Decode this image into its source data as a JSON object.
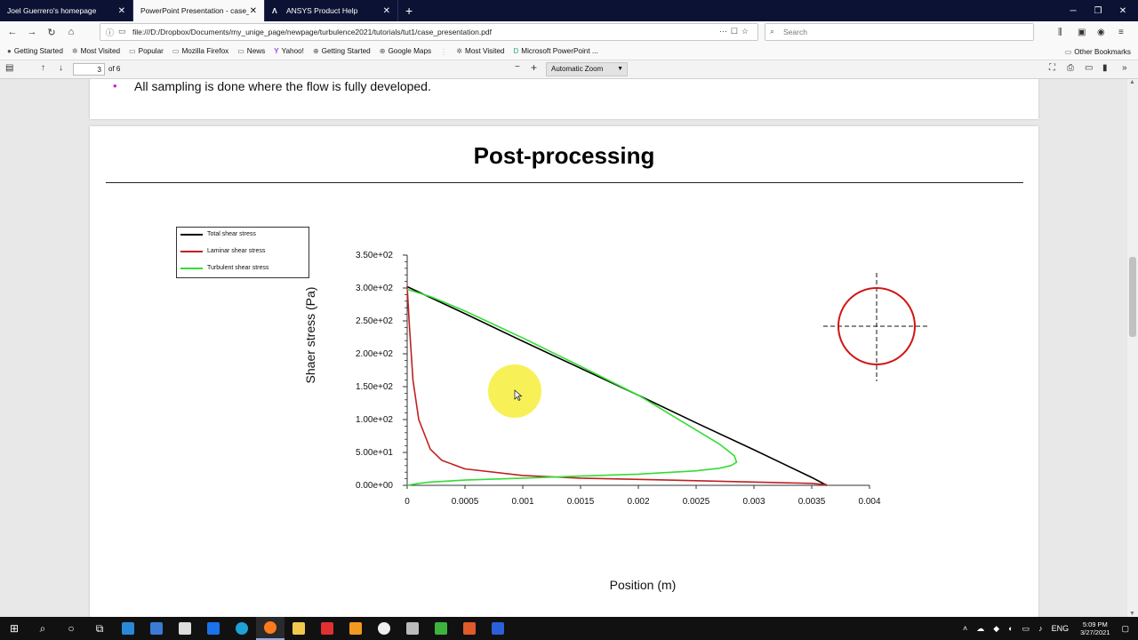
{
  "tabs": [
    {
      "label": "Joel Guerrero's homepage"
    },
    {
      "label": "PowerPoint Presentation - case_pre"
    },
    {
      "label": "ANSYS Product Help"
    }
  ],
  "url": "file:///D:/Dropbox/Documents/my_unige_page/newpage/turbulence2021/tutorials/tut1/case_presentation.pdf",
  "search_placeholder": "Search",
  "bookmarks": [
    "Getting Started",
    "Most Visited",
    "Popular",
    "Mozilla Firefox",
    "News",
    "Yahoo!",
    "Getting Started",
    "Google Maps",
    "Most Visited",
    "Microsoft PowerPoint ..."
  ],
  "other_bookmarks": "Other Bookmarks",
  "pdf": {
    "page": "3",
    "of": "of 6",
    "zoom": "Automatic Zoom"
  },
  "prev_slide": {
    "bullet": "•",
    "text": "All sampling is done where the flow is fully developed."
  },
  "slide": {
    "title": "Post-processing"
  },
  "chart_data": {
    "type": "line",
    "xlabel": "Position (m)",
    "ylabel": "Shaer stress (Pa)",
    "xlim": [
      0,
      0.004
    ],
    "ylim": [
      0,
      350
    ],
    "xticks": [
      "0",
      "0.0005",
      "0.001",
      "0.0015",
      "0.002",
      "0.0025",
      "0.003",
      "0.0035",
      "0.004"
    ],
    "yticks": [
      "0.00e+00",
      "5.00e+01",
      "1.00e+02",
      "1.50e+02",
      "2.00e+02",
      "2.50e+02",
      "3.00e+02",
      "3.50e+02"
    ],
    "legend_position": "top-left",
    "series": [
      {
        "name": "Total shear stress",
        "color": "#000000",
        "x": [
          0,
          0.0005,
          0.001,
          0.0015,
          0.002,
          0.0025,
          0.003,
          0.0035,
          0.00363
        ],
        "y": [
          302,
          261,
          219,
          178,
          137,
          95,
          54,
          12,
          0
        ]
      },
      {
        "name": "Laminar shear stress",
        "color": "#c02020",
        "x": [
          0,
          2e-05,
          5e-05,
          0.0001,
          0.0002,
          0.0003,
          0.0005,
          0.001,
          0.0015,
          0.002,
          0.0025,
          0.003,
          0.0035,
          0.00363
        ],
        "y": [
          302,
          240,
          160,
          100,
          55,
          38,
          25,
          15,
          11,
          9,
          7,
          5,
          3,
          1
        ]
      },
      {
        "name": "Turbulent shear stress",
        "color": "#33dd33",
        "x": [
          0,
          0.0001,
          0.0002,
          0.0005,
          0.001,
          0.0015,
          0.002,
          0.0025,
          0.0027,
          0.0028,
          0.00285,
          0.00283,
          0.0027,
          0.0025,
          0.002,
          0.0015,
          0.001,
          0.0005,
          0.0002,
          0
        ],
        "y": [
          0,
          3,
          5,
          8,
          11,
          14,
          17,
          22,
          26,
          30,
          35,
          45,
          63,
          84,
          137,
          181,
          224,
          265,
          287,
          298
        ]
      }
    ]
  },
  "taskbar": {
    "lang": "ENG",
    "time": "5:09 PM",
    "date": "3/27/2021"
  },
  "colors": {
    "accent": "#0c1233",
    "bullet": "#d21ad2"
  }
}
